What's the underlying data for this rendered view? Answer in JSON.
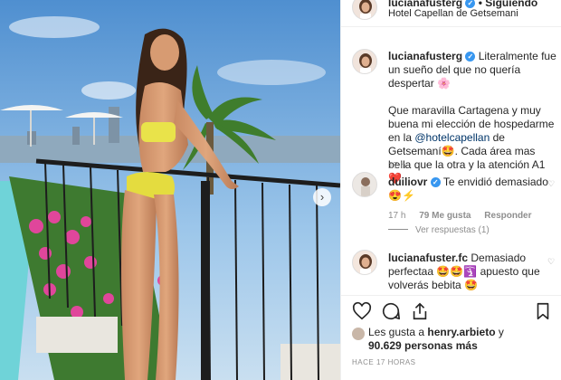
{
  "photo": {
    "alt_icon": "chevron-right-icon",
    "next_glyph": "›"
  },
  "header": {
    "username": "lucianafusterg",
    "separator": "•",
    "follow": "Siguiendo",
    "location": "Hotel Capellan de Getsemani"
  },
  "caption": {
    "username": "lucianafusterg",
    "text_part1": "Literalmente fue un sueño del que no quería despertar",
    "emoji1": "🌸",
    "text_part2": "Que maravilla Cartagena y muy buena mi elección de hospedarme en la",
    "mention": "@hotelcapellan",
    "text_part3": "de Getsemaní",
    "emoji2": "🤩",
    "text_part4": ". Cada área mas bella que la otra y la atención A1",
    "emoji3": "❤️",
    "time": "17 h"
  },
  "comment1": {
    "username": "duiliovr",
    "text": "Te envidió demasiado",
    "emojis": "😍⚡",
    "time": "17 h",
    "likes": "79 Me gusta",
    "reply": "Responder",
    "view_replies": "Ver respuestas (1)"
  },
  "comment2": {
    "username": "lucianafuster.fc",
    "text_part1": "Demasiado perfectaa",
    "emojis": "🤩🤩🛐",
    "text_part2": "apuesto que volverás bebita",
    "emoji_end": "🤩"
  },
  "likes": {
    "prefix": "Les gusta a",
    "first": "henry.arbieto",
    "mid": "y",
    "count": "90.629",
    "suffix": "personas más"
  },
  "timestamp": "HACE 17 HORAS",
  "colors": {
    "link": "#003569",
    "verified": "#3897f0",
    "muted": "#8e8e8e"
  }
}
